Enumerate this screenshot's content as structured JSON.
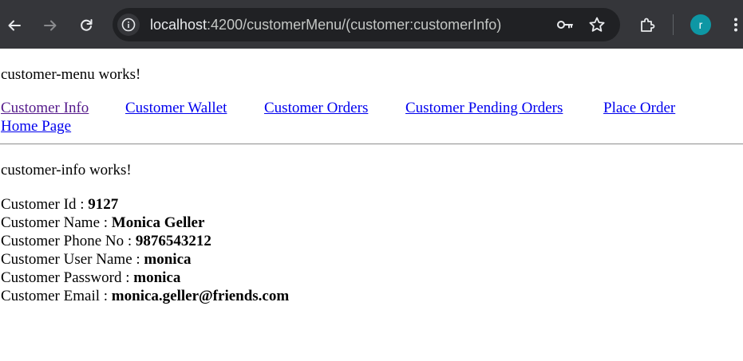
{
  "browser": {
    "url_host": "localhost",
    "url_rest": ":4200/customerMenu/(customer:customerInfo)",
    "profile_initial": "r"
  },
  "page": {
    "menu_heading": "customer-menu works!",
    "nav_links": [
      "Customer Info",
      "Customer Wallet",
      "Customer Orders",
      "Customer Pending Orders",
      "Place Order",
      "Home Page"
    ],
    "info_heading": "customer-info works!",
    "fields": [
      {
        "label": "Customer Id : ",
        "value": "9127"
      },
      {
        "label": "Customer Name : ",
        "value": "Monica Geller"
      },
      {
        "label": "Customer Phone No : ",
        "value": "9876543212"
      },
      {
        "label": "Customer User Name : ",
        "value": "monica"
      },
      {
        "label": "Customer Password : ",
        "value": "monica"
      },
      {
        "label": "Customer Email : ",
        "value": "monica.geller@friends.com"
      }
    ]
  },
  "colors": {
    "chrome_bg": "#35363a",
    "omnibox_bg": "#202124",
    "link": "#0000ee",
    "visited_link": "#551a8b",
    "avatar": "#0e97a4"
  }
}
